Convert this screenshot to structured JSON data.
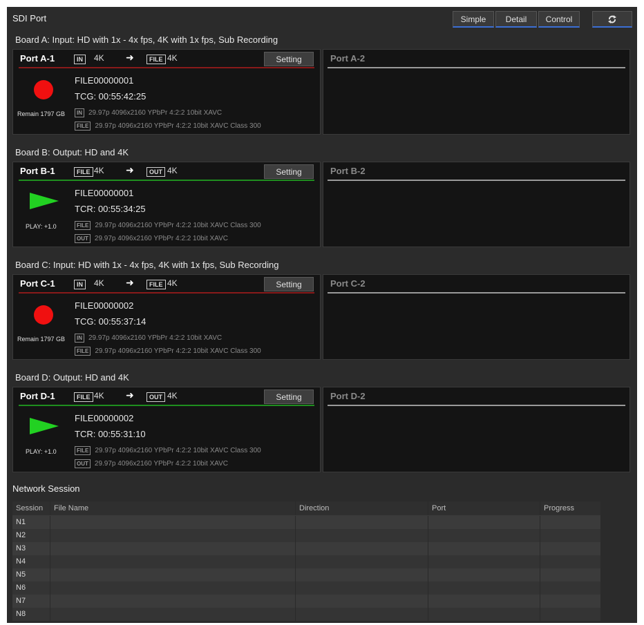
{
  "header": {
    "title": "SDI Port",
    "view_buttons": [
      "Simple",
      "Detail",
      "Control"
    ],
    "refresh_icon": "refresh-icon"
  },
  "boards": [
    {
      "title": "Board A: Input: HD with 1x - 4x fps, 4K with 1x fps, Sub Recording",
      "port1": {
        "name": "Port A-1",
        "src_tag": "IN",
        "src_fmt": "4K",
        "dst_tag": "FILE",
        "dst_fmt": "4K",
        "setting_label": "Setting",
        "mode": "record",
        "underline_color": "#8a1a1a",
        "file_name": "FILE00000001",
        "timecode": "TCG: 00:55:42:25",
        "side_text": "Remain 1797 GB",
        "info": [
          {
            "tag": "IN",
            "text": "29.97p 4096x2160 YPbPr 4:2:2 10bit XAVC"
          },
          {
            "tag": "FILE",
            "text": "29.97p 4096x2160 YPbPr 4:2:2 10bit XAVC Class 300"
          }
        ]
      },
      "port2": {
        "name": "Port A-2"
      }
    },
    {
      "title": "Board B: Output: HD and 4K",
      "port1": {
        "name": "Port B-1",
        "src_tag": "FILE",
        "src_fmt": "4K",
        "dst_tag": "OUT",
        "dst_fmt": "4K",
        "setting_label": "Setting",
        "mode": "play",
        "underline_color": "#1f8f1f",
        "file_name": "FILE00000001",
        "timecode": "TCR: 00:55:34:25",
        "side_text": "PLAY: +1.0",
        "info": [
          {
            "tag": "FILE",
            "text": "29.97p 4096x2160 YPbPr 4:2:2 10bit XAVC Class 300"
          },
          {
            "tag": "OUT",
            "text": "29.97p 4096x2160 YPbPr 4:2:2 10bit XAVC"
          }
        ]
      },
      "port2": {
        "name": "Port B-2"
      }
    },
    {
      "title": "Board C: Input: HD with 1x - 4x fps, 4K with 1x fps, Sub Recording",
      "port1": {
        "name": "Port C-1",
        "src_tag": "IN",
        "src_fmt": "4K",
        "dst_tag": "FILE",
        "dst_fmt": "4K",
        "setting_label": "Setting",
        "mode": "record",
        "underline_color": "#8a1a1a",
        "file_name": "FILE00000002",
        "timecode": "TCG: 00:55:37:14",
        "side_text": "Remain 1797 GB",
        "info": [
          {
            "tag": "IN",
            "text": "29.97p 4096x2160 YPbPr 4:2:2 10bit XAVC"
          },
          {
            "tag": "FILE",
            "text": "29.97p 4096x2160 YPbPr 4:2:2 10bit XAVC Class 300"
          }
        ]
      },
      "port2": {
        "name": "Port C-2"
      }
    },
    {
      "title": "Board D: Output: HD and 4K",
      "port1": {
        "name": "Port D-1",
        "src_tag": "FILE",
        "src_fmt": "4K",
        "dst_tag": "OUT",
        "dst_fmt": "4K",
        "setting_label": "Setting",
        "mode": "play",
        "underline_color": "#1f8f1f",
        "file_name": "FILE00000002",
        "timecode": "TCR: 00:55:31:10",
        "side_text": "PLAY: +1.0",
        "info": [
          {
            "tag": "FILE",
            "text": "29.97p 4096x2160 YPbPr 4:2:2 10bit XAVC Class 300"
          },
          {
            "tag": "OUT",
            "text": "29.97p 4096x2160 YPbPr 4:2:2 10bit XAVC"
          }
        ]
      },
      "port2": {
        "name": "Port D-2"
      }
    }
  ],
  "network": {
    "title": "Network Session",
    "columns": [
      "Session",
      "File Name",
      "Direction",
      "Port",
      "Progress"
    ],
    "rows": [
      "N1",
      "N2",
      "N3",
      "N4",
      "N5",
      "N6",
      "N7",
      "N8"
    ]
  }
}
